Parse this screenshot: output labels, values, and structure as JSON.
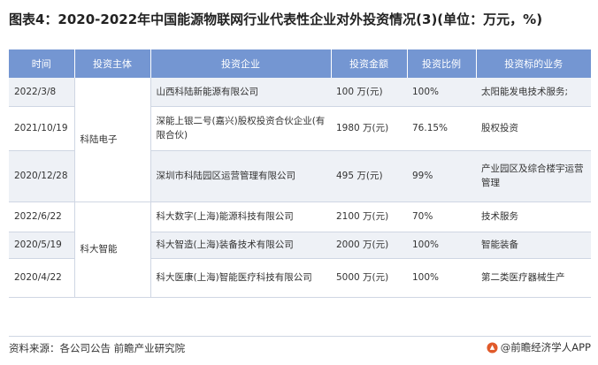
{
  "title": "图表4：2020-2022年中国能源物联网行业代表性企业对外投资情况(3)(单位：万元，%)",
  "headers": [
    "时间",
    "投资主体",
    "投资企业",
    "投资金额",
    "投资比例",
    "投资标的业务"
  ],
  "groups": [
    {
      "investor": "科陆电子",
      "rows": [
        {
          "time": "2022/3/8",
          "company": "山西科陆新能源有限公司",
          "amount": "100 万(元)",
          "ratio": "100%",
          "business": "太阳能发电技术服务;"
        },
        {
          "time": "2021/10/19",
          "company": "深能上银二号(嘉兴)股权投资合伙企业(有限合伙)",
          "amount": "1980 万(元)",
          "ratio": "76.15%",
          "business": "股权投资"
        },
        {
          "time": "2020/12/28",
          "company": "深圳市科陆园区运营管理有限公司",
          "amount": "495 万(元)",
          "ratio": "99%",
          "business": "产业园区及综合楼宇运营管理"
        }
      ]
    },
    {
      "investor": "科大智能",
      "rows": [
        {
          "time": "2022/6/22",
          "company": "科大数字(上海)能源科技有限公司",
          "amount": "2100 万(元)",
          "ratio": "70%",
          "business": "技术服务"
        },
        {
          "time": "2020/5/19",
          "company": "科大智造(上海)装备技术有限公司",
          "amount": "2000 万(元)",
          "ratio": "100%",
          "business": "智能装备"
        },
        {
          "time": "2020/4/22",
          "company": "科大医康(上海)智能医疗科技有限公司",
          "amount": "5000 万(元)",
          "ratio": "100%",
          "business": "第二类医疗器械生产"
        }
      ]
    }
  ],
  "footer": {
    "source": "资料来源：各公司公告 前瞻产业研究院",
    "brand": "@前瞻经济学人APP"
  },
  "colors": {
    "header_bg": "#7496d2",
    "stripe": "#eef1f6",
    "logo": "#e05a2a"
  },
  "icons": {
    "brand_logo": "qianzhan-logo-icon"
  }
}
